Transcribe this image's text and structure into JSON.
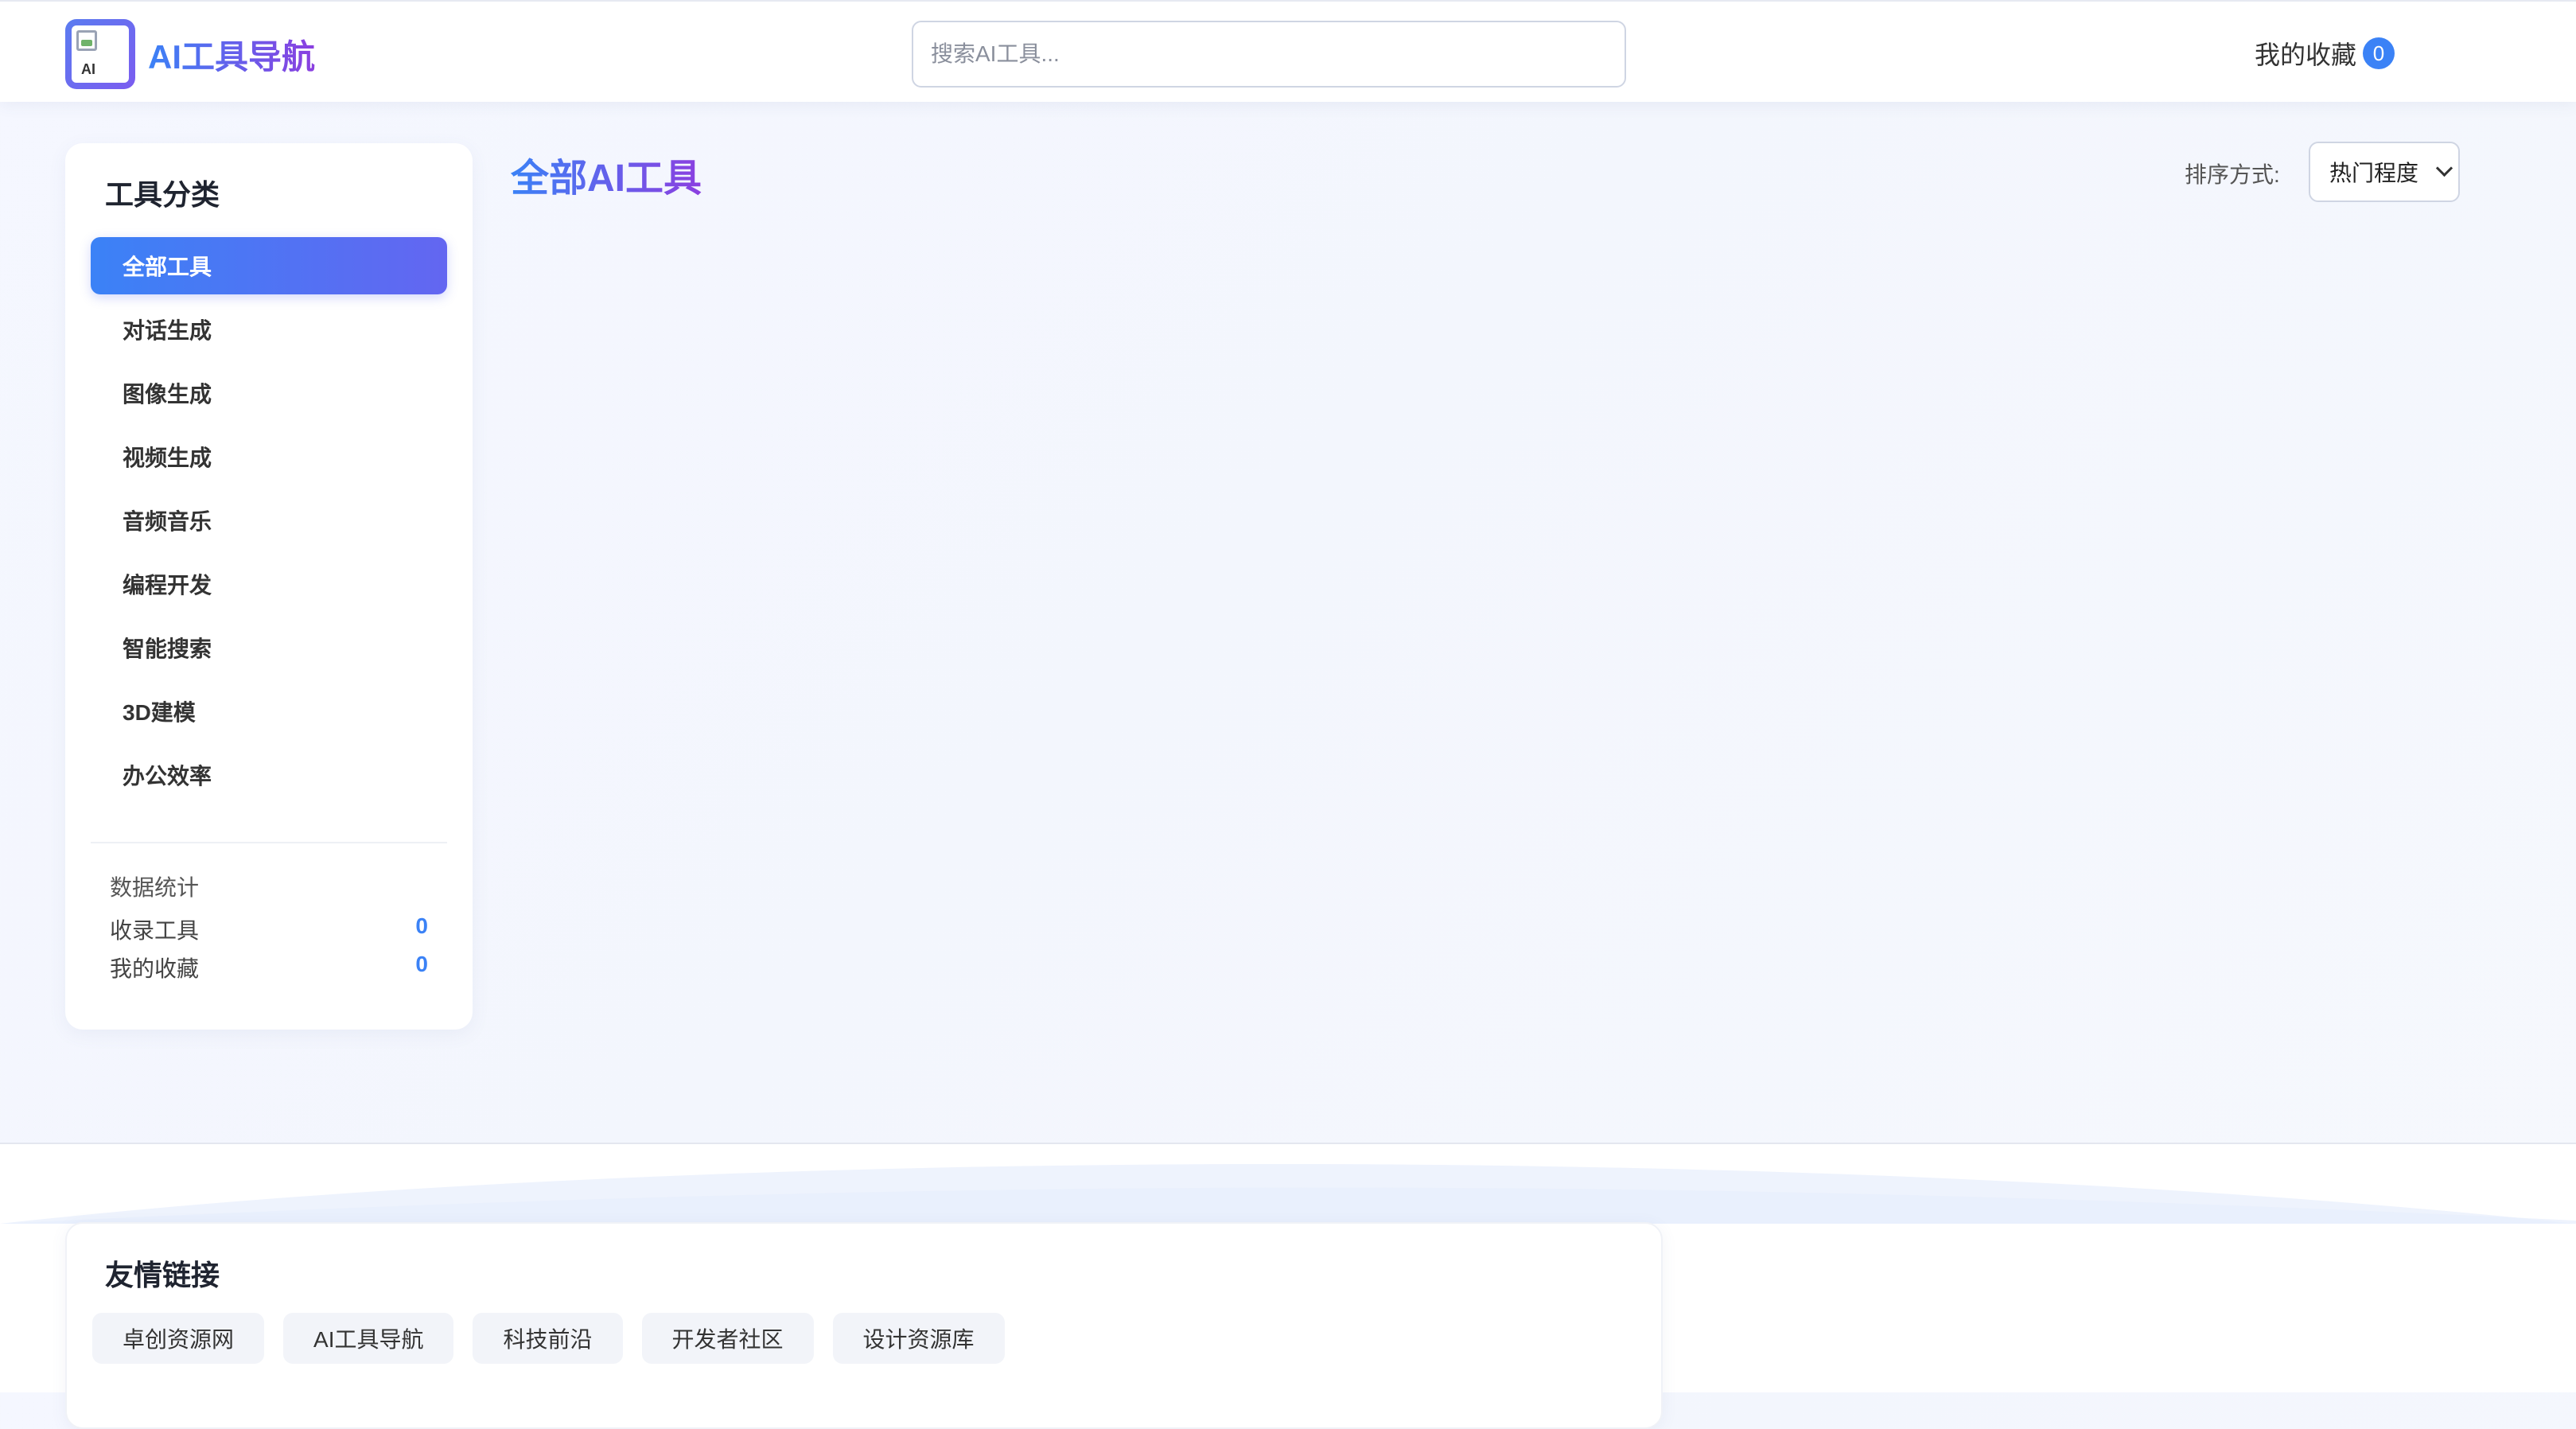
{
  "header": {
    "logo_alt": "AI",
    "brand": "AI工具导航",
    "search_placeholder": "搜索AI工具...",
    "favorites_label": "我的收藏",
    "favorites_count": "0"
  },
  "sidebar": {
    "title": "工具分类",
    "categories": [
      {
        "label": "全部工具",
        "active": true
      },
      {
        "label": "对话生成",
        "active": false
      },
      {
        "label": "图像生成",
        "active": false
      },
      {
        "label": "视频生成",
        "active": false
      },
      {
        "label": "音频音乐",
        "active": false
      },
      {
        "label": "编程开发",
        "active": false
      },
      {
        "label": "智能搜索",
        "active": false
      },
      {
        "label": "3D建模",
        "active": false
      },
      {
        "label": "办公效率",
        "active": false
      }
    ],
    "stats": {
      "title": "数据统计",
      "tools_label": "收录工具",
      "tools_value": "0",
      "favorites_label": "我的收藏",
      "favorites_value": "0"
    }
  },
  "main": {
    "title": "全部AI工具",
    "sort_label": "排序方式:",
    "sort_value": "热门程度"
  },
  "footer": {
    "links_title": "友情链接",
    "links": [
      "卓创资源网",
      "AI工具导航",
      "科技前沿",
      "开发者社区",
      "设计资源库"
    ]
  },
  "colors": {
    "accent_blue": "#3b82f6",
    "accent_purple": "#8b3fe0",
    "page_bg": "#f4f6fd"
  }
}
